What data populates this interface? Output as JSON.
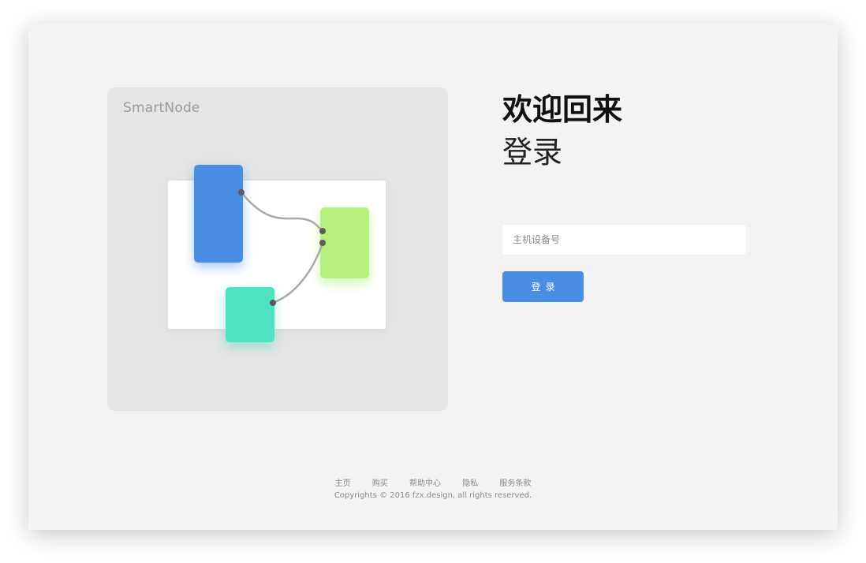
{
  "brand": {
    "name": "SmartNode"
  },
  "login": {
    "title": "欢迎回来",
    "subtitle": "登录",
    "host_placeholder": "主机设备号",
    "submit_label": "登录"
  },
  "illustration": {
    "colors": {
      "panel": "#e5e5e5",
      "canvas": "#ffffff",
      "node_blue": "#4a8ee4",
      "node_green": "#b8f07e",
      "node_teal": "#4de3c1",
      "wire": "#a8a8a8",
      "port": "#5a5a5a"
    }
  },
  "footer": {
    "links": [
      "主页",
      "购买",
      "帮助中心",
      "隐私",
      "服务条款"
    ],
    "copyright": "Copyrights © 2016 fzx.design, all rights reserved."
  },
  "theme": {
    "accent": "#4a8ee4",
    "background": "#f3f3f3"
  }
}
